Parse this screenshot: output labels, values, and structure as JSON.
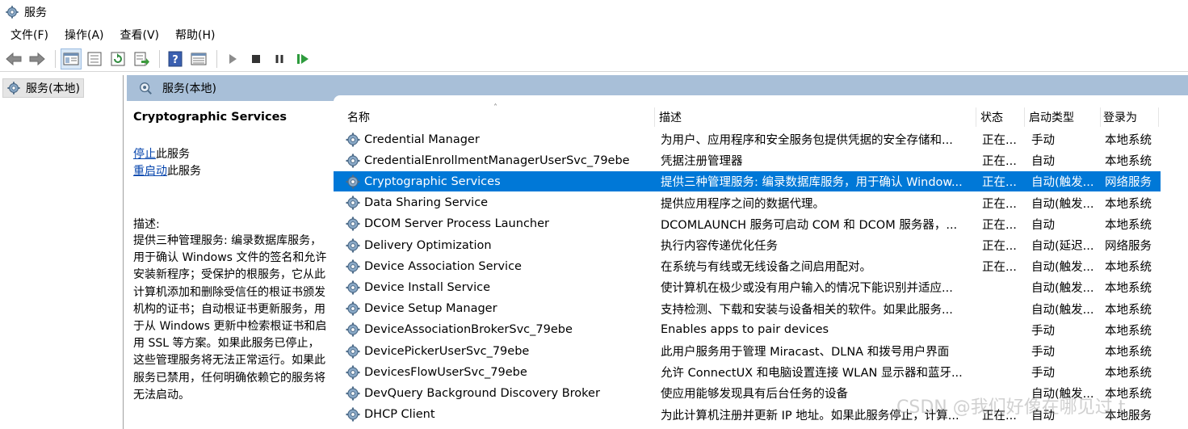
{
  "window": {
    "title": "服务"
  },
  "menu": [
    "文件(F)",
    "操作(A)",
    "查看(V)",
    "帮助(H)"
  ],
  "toolbar": {
    "buttons": [
      "back-icon",
      "forward-icon",
      "show-hide-tree-icon",
      "properties-icon",
      "refresh-icon",
      "export-list-icon",
      "help-icon",
      "view-icon",
      "start-icon",
      "stop-icon",
      "pause-icon",
      "resume-icon"
    ]
  },
  "tree": {
    "root_label": "服务(本地)"
  },
  "pane": {
    "header": "服务(本地)",
    "selected_title": "Cryptographic Services",
    "action_stop_link": "停止",
    "action_stop_suffix": "此服务",
    "action_restart_link": "重启动",
    "action_restart_suffix": "此服务",
    "desc_label": "描述:",
    "desc_text": "提供三种管理服务: 编录数据库服务，用于确认 Windows 文件的签名和允许安装新程序；受保护的根服务，它从此计算机添加和删除受信任的根证书颁发机构的证书；自动根证书更新服务，用于从 Windows 更新中检索根证书和启用 SSL 等方案。如果此服务已停止，这些管理服务将无法正常运行。如果此服务已禁用，任何明确依赖它的服务将无法启动。"
  },
  "columns": {
    "name": "名称",
    "description": "描述",
    "status": "状态",
    "startup": "启动类型",
    "logon": "登录为"
  },
  "rows": [
    {
      "name": "Credential Manager",
      "description": "为用户、应用程序和安全服务包提供凭据的安全存储和...",
      "status": "正在...",
      "startup": "手动",
      "logon": "本地系统"
    },
    {
      "name": "CredentialEnrollmentManagerUserSvc_79ebe",
      "description": "凭据注册管理器",
      "status": "正在...",
      "startup": "自动",
      "logon": "本地系统"
    },
    {
      "name": "Cryptographic Services",
      "description": "提供三种管理服务: 编录数据库服务，用于确认 Window...",
      "status": "正在...",
      "startup": "自动(触发...",
      "logon": "网络服务",
      "selected": true
    },
    {
      "name": "Data Sharing Service",
      "description": "提供应用程序之间的数据代理。",
      "status": "正在...",
      "startup": "自动(触发...",
      "logon": "本地系统"
    },
    {
      "name": "DCOM Server Process Launcher",
      "description": "DCOMLAUNCH 服务可启动 COM 和 DCOM 服务器，...",
      "status": "正在...",
      "startup": "自动",
      "logon": "本地系统"
    },
    {
      "name": "Delivery Optimization",
      "description": "执行内容传递优化任务",
      "status": "正在...",
      "startup": "自动(延迟...",
      "logon": "网络服务"
    },
    {
      "name": "Device Association Service",
      "description": "在系统与有线或无线设备之间启用配对。",
      "status": "正在...",
      "startup": "自动(触发...",
      "logon": "本地系统"
    },
    {
      "name": "Device Install Service",
      "description": "使计算机在极少或没有用户输入的情况下能识别并适应...",
      "status": "",
      "startup": "自动(触发...",
      "logon": "本地系统"
    },
    {
      "name": "Device Setup Manager",
      "description": "支持检测、下载和安装与设备相关的软件。如果此服务...",
      "status": "",
      "startup": "自动(触发...",
      "logon": "本地系统"
    },
    {
      "name": "DeviceAssociationBrokerSvc_79ebe",
      "description": "Enables apps to pair devices",
      "status": "",
      "startup": "手动",
      "logon": "本地系统"
    },
    {
      "name": "DevicePickerUserSvc_79ebe",
      "description": "此用户服务用于管理 Miracast、DLNA 和拨号用户界面",
      "status": "",
      "startup": "手动",
      "logon": "本地系统"
    },
    {
      "name": "DevicesFlowUserSvc_79ebe",
      "description": "允许 ConnectUX 和电脑设置连接 WLAN 显示器和蓝牙...",
      "status": "",
      "startup": "手动",
      "logon": "本地系统"
    },
    {
      "name": "DevQuery Background Discovery Broker",
      "description": "使应用能够发现具有后台任务的设备",
      "status": "",
      "startup": "自动(触发...",
      "logon": "本地系统"
    },
    {
      "name": "DHCP Client",
      "description": "为此计算机注册并更新 IP 地址。如果此服务停止，计算...",
      "status": "正在...",
      "startup": "自动",
      "logon": "本地服务"
    }
  ],
  "watermark": "CSDN @我们好像在哪见过 t"
}
